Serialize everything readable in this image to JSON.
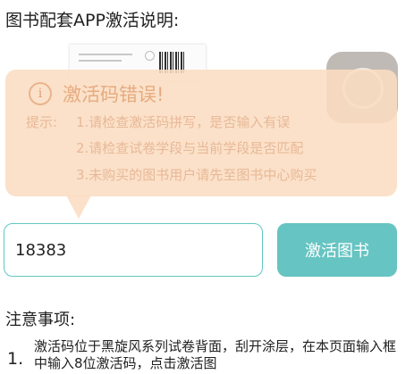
{
  "header": {
    "title": "图书配套APP激活说明:"
  },
  "error_popup": {
    "icon": "info-icon",
    "icon_glyph": "i",
    "title": "激活码错误!",
    "tips_prefix": "提示:",
    "tips": [
      "1.请检查激活码拼写，是否输入有误",
      "2.请检查试卷学段与当前学段是否匹配",
      "3.未购买的图书用户请先至图书中心购买"
    ],
    "background_color": "#fadcc2",
    "text_color": "#e8b897"
  },
  "activation": {
    "input_value": "18383",
    "button_label": "激活图书",
    "accent_color": "#66c4c2"
  },
  "notes": {
    "title": "注意事项:",
    "items": [
      {
        "number": "1.",
        "text": "激活码位于黑旋风系列试卷背面，刮开涂层，在本页面输入框中输入8位激活码，点击激活图"
      }
    ]
  }
}
